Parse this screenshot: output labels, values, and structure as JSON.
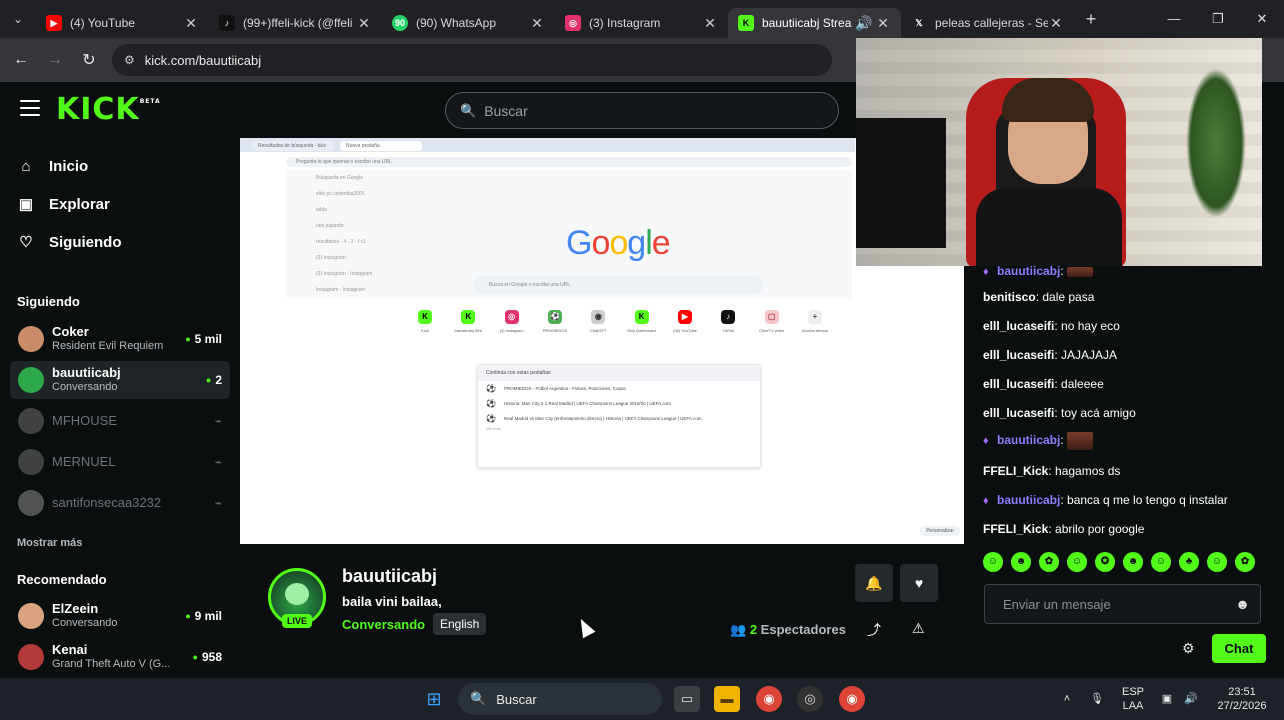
{
  "browser": {
    "tabs": [
      {
        "title": "(4) YouTube",
        "icon": "youtube-icon",
        "color": "#ff0000"
      },
      {
        "title": "(99+)ffeli-kick (@ffeli",
        "icon": "tiktok-icon",
        "color": "#111111"
      },
      {
        "title": "(90) WhatsApp",
        "icon": "whatsapp-icon",
        "color": "#25d366",
        "badge": "90"
      },
      {
        "title": "(3) Instagram",
        "icon": "instagram-icon",
        "color": "#e1306c"
      },
      {
        "title": "bauutiicabj Strea",
        "icon": "kick-icon",
        "color": "#53fc18",
        "active": true
      },
      {
        "title": "peleas callejeras - Se",
        "icon": "x-icon",
        "color": "#000000"
      }
    ],
    "url": "kick.com/bauutiicabj"
  },
  "kick": {
    "logo": "KICK",
    "logo_beta": "BETA",
    "search_placeholder": "Buscar",
    "nav": [
      {
        "label": "Inicio",
        "icon": "home-icon"
      },
      {
        "label": "Explorar",
        "icon": "compass-icon"
      },
      {
        "label": "Siguiendo",
        "icon": "heart-icon"
      }
    ],
    "following_title": "Siguiendo",
    "following": [
      {
        "name": "Coker",
        "sub": "Resident Evil Requiem",
        "count": "5 mil"
      },
      {
        "name": "bauutiicabj",
        "sub": "Conversando",
        "count": "2"
      },
      {
        "name": "MFHOUSE"
      },
      {
        "name": "MERNUEL"
      },
      {
        "name": "santifonsecaa3232"
      }
    ],
    "show_more": "Mostrar más",
    "recommended_title": "Recomendado",
    "recommended": [
      {
        "name": "ElZeein",
        "sub": "Conversando",
        "count": "9 mil"
      },
      {
        "name": "Kenai",
        "sub": "Grand Theft Auto V (G...",
        "count": "958"
      }
    ]
  },
  "player_screen": {
    "tabs": [
      "Resultados de búsqueda - bús",
      "Nueva pestaña"
    ],
    "omnibox": "Pregunta lo que quieras o escribe una URL",
    "google_logo": "Google",
    "google_search": "Busca en Google o escribe una URL",
    "suggestions": [
      "Búsqueda en Google",
      "elite pc colombia2005",
      "tabla",
      "uno jugando",
      "resultados - 4 - 3 - f c1",
      "(3) Instagram",
      "(3) Instagram - Instagram",
      "Instagram - Instagram"
    ],
    "shortcuts": [
      "Kick",
      "bauutiicabj Stre",
      "(3) Instagram",
      "PROMIEDOS",
      "ChatGPT",
      "Kick Dashboard",
      "(38) YouTube",
      "TikTok",
      "ChezTV video",
      "Acceso directo"
    ],
    "card_title": "Continúa con estas pestañas",
    "card_rows": [
      "PROMIEDOS - Fútbol Argentino - Fixture, Posiciones, Copas",
      "Historia: Man City 2-1 Real Madrid | UEFA Champions League 2019/20 | UEFA.com",
      "Real Madrid vs Man City (enfrentamiento directo) | Historia | UEFA Champions League | UEFA.com"
    ],
    "card_more": "Ver más",
    "personalize": "Personalizar"
  },
  "chat": {
    "messages": [
      {
        "user": "bauutiicabj",
        "text": "",
        "color": "#8f7dff",
        "badge": true,
        "emote": true
      },
      {
        "user": "benitisco",
        "text": "dale pasa",
        "color": "#ffffff"
      },
      {
        "user": "elll_lucaseifi",
        "text": "no hay eco",
        "color": "#ffffff"
      },
      {
        "user": "elll_lucaseifi",
        "text": "JAJAJAJA",
        "color": "#ffffff"
      },
      {
        "user": "elll_lucaseifi",
        "text": "daleeee",
        "color": "#ffffff"
      },
      {
        "user": "elll_lucaseifi",
        "text": "toy acá amigo",
        "color": "#ffffff"
      },
      {
        "user": "bauutiicabj",
        "text": "",
        "color": "#8f7dff",
        "badge": true,
        "emote": true
      },
      {
        "user": "FFELI_Kick",
        "text": "hagamos ds",
        "color": "#ffffff"
      },
      {
        "user": "bauutiicabj",
        "text": "banca q me lo tengo q instalar",
        "color": "#8f7dff",
        "badge": true
      },
      {
        "user": "FFELI_Kick",
        "text": "abrilo por google",
        "color": "#ffffff"
      }
    ],
    "input_placeholder": "Enviar un mensaje",
    "send_label": "Chat"
  },
  "stream": {
    "username": "bauutiicabj",
    "title": "baila vini bailaa,",
    "category": "Conversando",
    "tag": "English",
    "live": "LIVE",
    "viewers_count": "2",
    "viewers_label": "Espectadores"
  },
  "taskbar": {
    "search": "Buscar",
    "lang": "ESP",
    "lang2": "LAA",
    "time": "23:51",
    "date": "27/2/2026"
  },
  "colors": {
    "accent": "#53fc18",
    "bg": "#0b0e0f"
  }
}
